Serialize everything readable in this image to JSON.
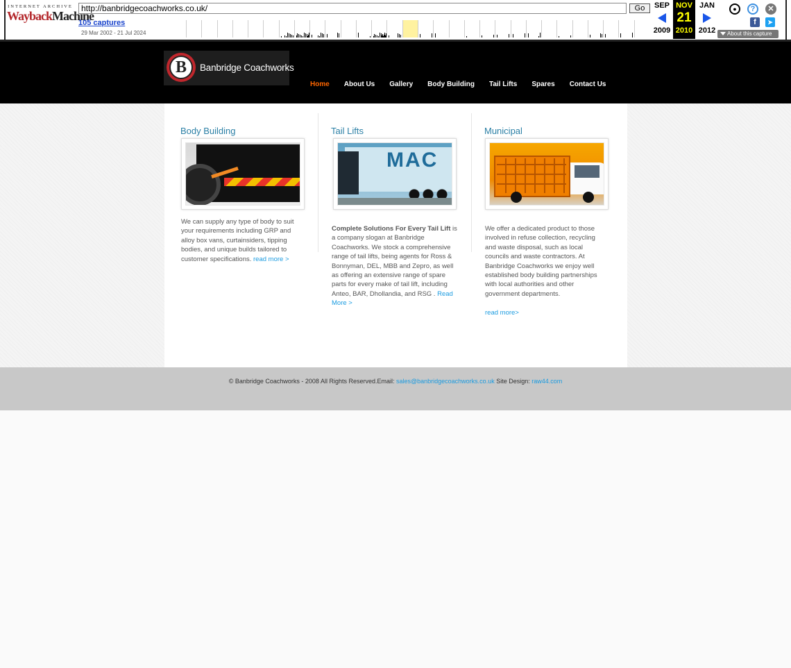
{
  "wayback": {
    "logo_line1": "INTERNET ARCHIVE",
    "logo_line2a": "Wayback",
    "logo_line2b": "Machine",
    "url": "http://banbridgecoachworks.co.uk/",
    "go_label": "Go",
    "captures_label": "105 captures",
    "date_range": "29 Mar 2002 - 21 Jul 2024",
    "prev": {
      "month": "SEP",
      "year": "2009"
    },
    "current": {
      "month": "NOV",
      "day": "21",
      "year": "2010"
    },
    "next": {
      "month": "JAN",
      "year": "2012"
    },
    "about_label": "About this capture",
    "icons": [
      "user-icon",
      "help-icon",
      "close-icon",
      "facebook-icon",
      "twitter-icon"
    ]
  },
  "site": {
    "logo_letter": "B",
    "logo_text": "Banbridge Coachworks",
    "nav": [
      {
        "label": "Home",
        "active": true
      },
      {
        "label": "About Us"
      },
      {
        "label": "Gallery"
      },
      {
        "label": "Body Building"
      },
      {
        "label": "Tail Lifts"
      },
      {
        "label": "Spares"
      },
      {
        "label": "Contact Us"
      }
    ],
    "accent_color": "#2a7fa5",
    "link_color": "#1a9be0",
    "nav_active_color": "#ff6600"
  },
  "columns": [
    {
      "title": "Body Building",
      "text": "We can supply any type of body to suit your requirements including GRP and alloy box vans, curtainsiders, tipping bodies, and unique builds tailored to customer specifications.",
      "link": "read more >"
    },
    {
      "title": "Tail Lifts",
      "image_text": "MAC",
      "lead": "Complete Solutions For Every Tail Lift",
      "text": "is a company slogan at Banbridge Coachworks. We stock a comprehensive range of tail lifts, being agents for Ross & Bonnyman, DEL, MBB and Zepro, as well as offering an extensive range of spare parts for every make of tail lift, including Anteo, BAR, Dhollandia, and RSG .",
      "link": "Read More >"
    },
    {
      "title": "Municipal",
      "text": "We offer a dedicated product to those involved in refuse collection, recycling and waste disposal, such as local councils and waste contractors. At Banbridge Coachworks we enjoy well established body building partnerships with local authorities and other government departments.",
      "link": "read more>"
    }
  ],
  "footer": {
    "copyright": "© Banbridge Coachworks - 2008 All Rights Reserved.Email: ",
    "email": "sales@banbridgecoachworks.co.uk",
    "design_label": " Site Design: ",
    "designer": "raw44.com"
  }
}
